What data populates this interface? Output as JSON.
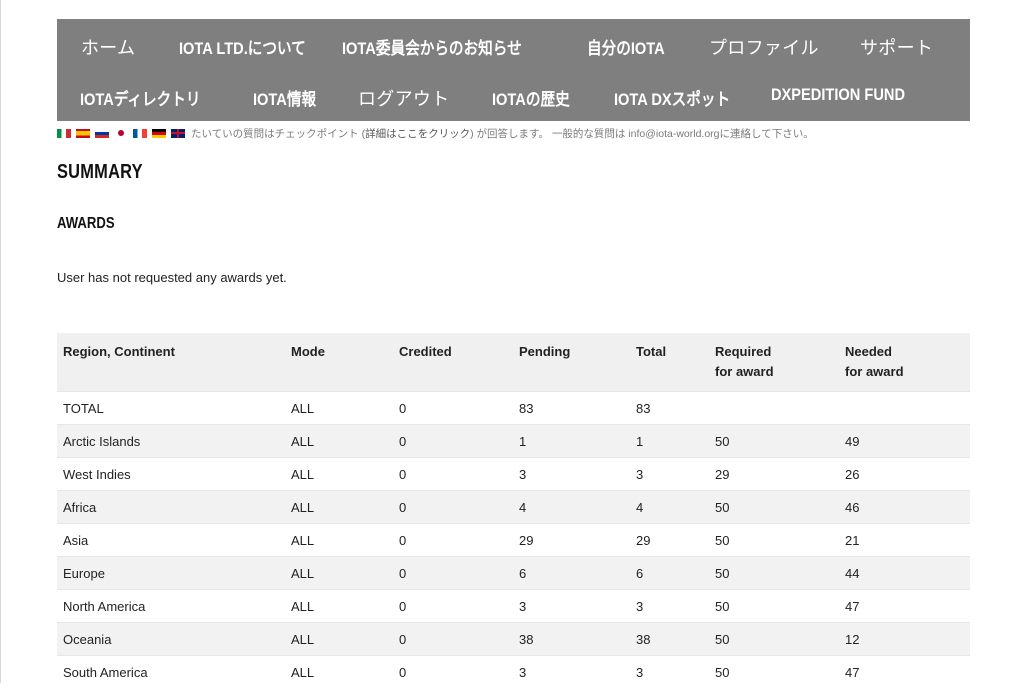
{
  "nav": {
    "row1": [
      {
        "label": "ホーム",
        "bold": false
      },
      {
        "label": "IOTA LTD.について",
        "bold": true
      },
      {
        "label": "IOTA委員会からのお知らせ",
        "bold": true
      },
      {
        "label": "自分のIOTA",
        "bold": true
      },
      {
        "label": "プロファイル",
        "bold": false
      },
      {
        "label": "サポート",
        "bold": false
      }
    ],
    "row2": [
      {
        "label": "IOTAディレクトリ",
        "bold": true
      },
      {
        "label": "IOTA情報",
        "bold": true
      },
      {
        "label": "ログアウト",
        "bold": false
      },
      {
        "label": "IOTAの歴史",
        "bold": true
      },
      {
        "label": "IOTA DXスポット",
        "bold": true
      },
      {
        "label": "DXPEDITION FUND",
        "bold": true
      }
    ]
  },
  "notice": {
    "flags": [
      "it",
      "es",
      "ru",
      "jp",
      "fr",
      "de",
      "gb"
    ],
    "text_before": "たいていの質問はチェックポイント (",
    "link": "詳細はここをクリック",
    "text_after": " ) が回答します。 一般的な質問は info@iota-world.orgに連絡して下さい。"
  },
  "summary_title": "SUMMARY",
  "awards_title": "AWARDS",
  "no_awards_text": "User has not requested any awards yet.",
  "table": {
    "headers": [
      "Region, Continent",
      "Mode",
      "Credited",
      "Pending",
      "Total",
      "Required\nfor award",
      "Needed\nfor award"
    ],
    "header_lines": {
      "required_1": "Required",
      "required_2": "for award",
      "needed_1": "Needed",
      "needed_2": "for award"
    },
    "rows": [
      [
        "TOTAL",
        "ALL",
        "0",
        "83",
        "83",
        "",
        ""
      ],
      [
        "Arctic Islands",
        "ALL",
        "0",
        "1",
        "1",
        "50",
        "49"
      ],
      [
        "West Indies",
        "ALL",
        "0",
        "3",
        "3",
        "29",
        "26"
      ],
      [
        "Africa",
        "ALL",
        "0",
        "4",
        "4",
        "50",
        "46"
      ],
      [
        "Asia",
        "ALL",
        "0",
        "29",
        "29",
        "50",
        "21"
      ],
      [
        "Europe",
        "ALL",
        "0",
        "6",
        "6",
        "50",
        "44"
      ],
      [
        "North America",
        "ALL",
        "0",
        "3",
        "3",
        "50",
        "47"
      ],
      [
        "Oceania",
        "ALL",
        "0",
        "38",
        "38",
        "50",
        "12"
      ],
      [
        "South America",
        "ALL",
        "0",
        "3",
        "3",
        "50",
        "47"
      ]
    ]
  }
}
